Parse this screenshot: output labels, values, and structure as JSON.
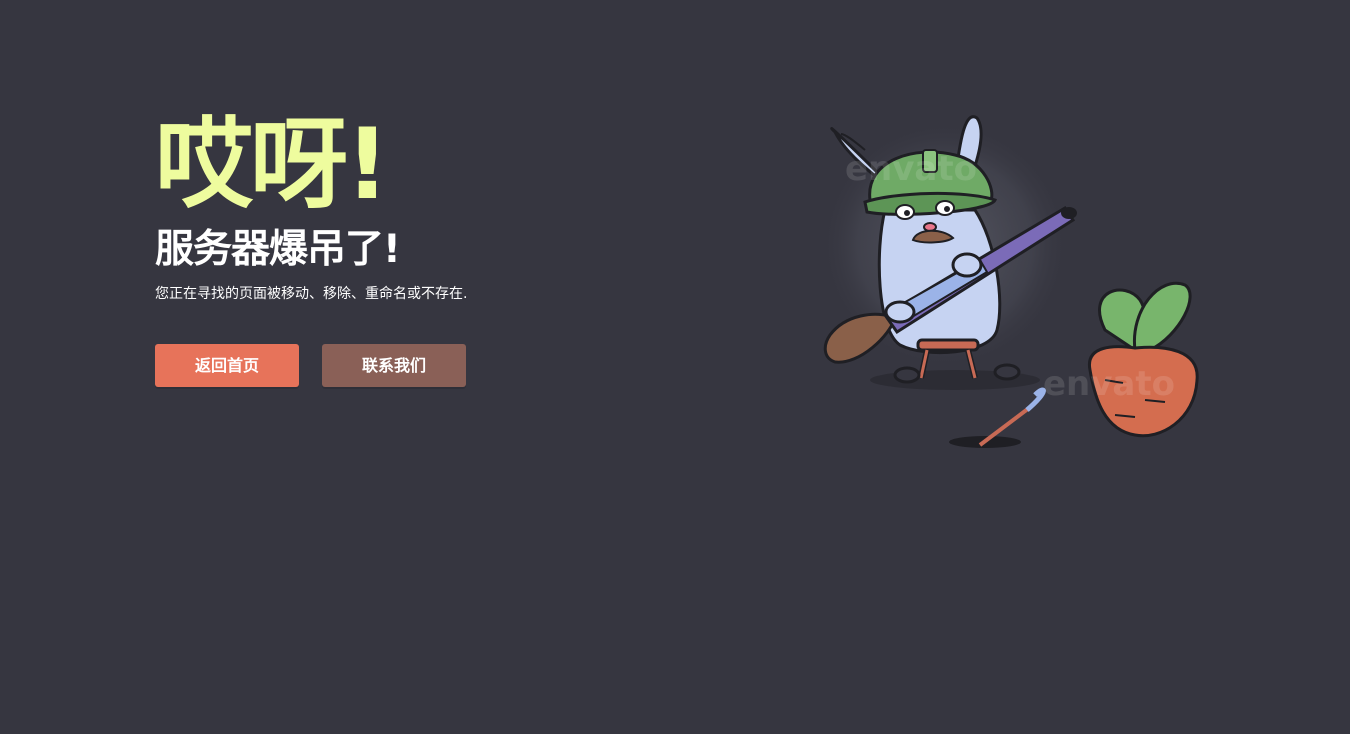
{
  "error": {
    "title": "哎呀!",
    "subtitle": "服务器爆吊了!",
    "description": "您正在寻找的页面被移动、移除、重命名或不存在."
  },
  "actions": {
    "home_label": "返回首页",
    "contact_label": "联系我们"
  },
  "illustration": {
    "watermark": "envato"
  },
  "colors": {
    "background": "#363640",
    "title": "#eefc9e",
    "home_button": "#e7735a",
    "contact_button": "#8a6057"
  }
}
